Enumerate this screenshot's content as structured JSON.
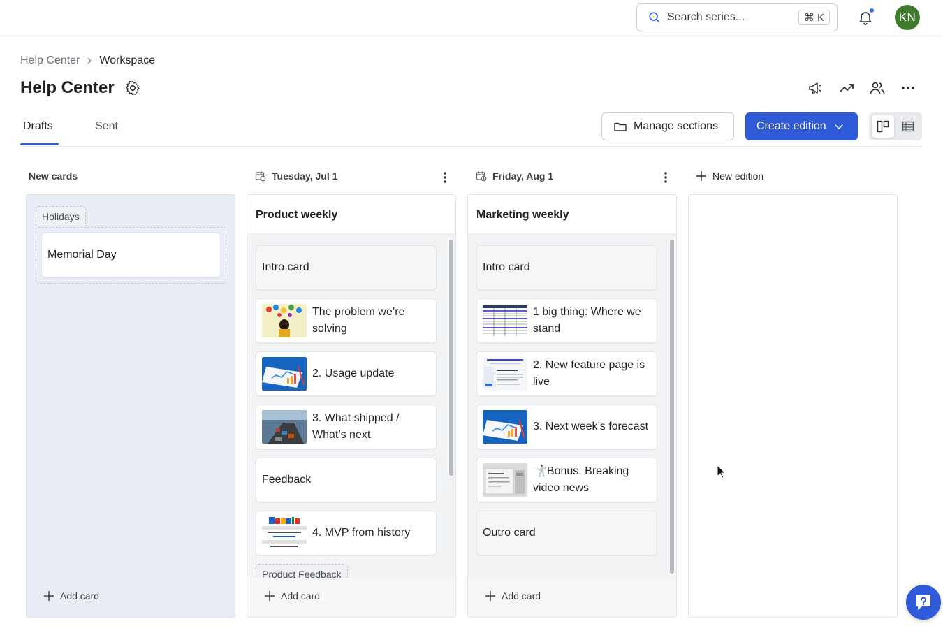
{
  "topbar": {
    "search_placeholder": "Search series...",
    "shortcut": "⌘ K",
    "avatar_initials": "KN",
    "avatar_color": "#3f7a2d",
    "notification_dot_color": "#2f6fed"
  },
  "breadcrumb": {
    "parent": "Help Center",
    "current": "Workspace"
  },
  "page": {
    "title": "Help Center"
  },
  "tabs": [
    {
      "label": "Drafts",
      "active": true
    },
    {
      "label": "Sent",
      "active": false
    }
  ],
  "toolbar": {
    "manage_label": "Manage sections",
    "create_label": "Create edition",
    "accent_color": "#2f5bd8"
  },
  "columns": {
    "new_cards": {
      "header": "New cards",
      "group_label": "Holidays",
      "cards": [
        {
          "title": "Memorial Day"
        }
      ],
      "add_label": "Add card"
    },
    "edition1": {
      "date": "Tuesday, Jul 1",
      "title": "Product weekly",
      "cards": [
        {
          "title": "Intro card",
          "thumb": "none"
        },
        {
          "title": "The problem we’re solving",
          "thumb": "social-icons"
        },
        {
          "title": "2. Usage update",
          "thumb": "chart-blue"
        },
        {
          "title": "3. What shipped / What’s next",
          "thumb": "ship"
        },
        {
          "title": "Feedback",
          "thumb": "none"
        },
        {
          "title": "4. MVP from history",
          "thumb": "google-page"
        }
      ],
      "group_label": "Product Feedback",
      "add_label": "Add card"
    },
    "edition2": {
      "date": "Friday, Aug 1",
      "title": "Marketing weekly",
      "cards": [
        {
          "title": "Intro card",
          "thumb": "none"
        },
        {
          "title": "1 big thing: Where we stand",
          "thumb": "spreadsheet"
        },
        {
          "title": "2. New feature page is live",
          "thumb": "webpage"
        },
        {
          "title": "3. Next week’s forecast",
          "thumb": "chart-blue"
        },
        {
          "title": "🤺Bonus: Breaking video news",
          "thumb": "video-ui"
        },
        {
          "title": "Outro card",
          "thumb": "none"
        }
      ],
      "add_label": "Add card"
    },
    "new_edition_label": "New edition"
  }
}
